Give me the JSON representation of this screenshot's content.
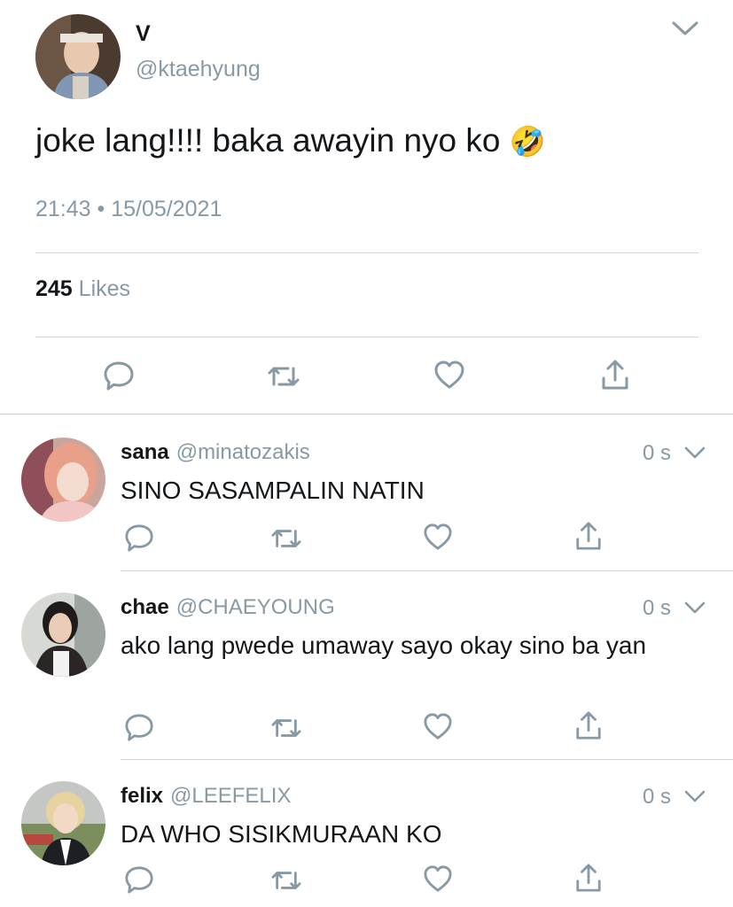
{
  "tweet": {
    "display_name": "V",
    "handle": "@ktaehyung",
    "text": "joke lang!!!! baka awayin nyo ko",
    "emoji": "🤣",
    "time": "21:43",
    "separator": "•",
    "date": "15/05/2021",
    "likes_count": "245",
    "likes_label": "Likes"
  },
  "replies": [
    {
      "name": "sana",
      "handle": "@minatozakis",
      "time": "0 s",
      "text": "SINO SASAMPALIN NATIN"
    },
    {
      "name": "chae",
      "handle": "@CHAEYOUNG",
      "time": "0 s",
      "text": "ako lang pwede umaway sayo okay sino ba yan"
    },
    {
      "name": "felix",
      "handle": "@LEEFELIX",
      "time": "0 s",
      "text": "DA WHO SISIKMURAAN KO"
    }
  ],
  "colors": {
    "icon": "#8899a6",
    "divider": "#d0d6da",
    "text": "#14171a",
    "muted": "#8899a6"
  },
  "icons": [
    "chevron-down-icon",
    "reply-icon",
    "retweet-icon",
    "like-icon",
    "share-icon"
  ]
}
